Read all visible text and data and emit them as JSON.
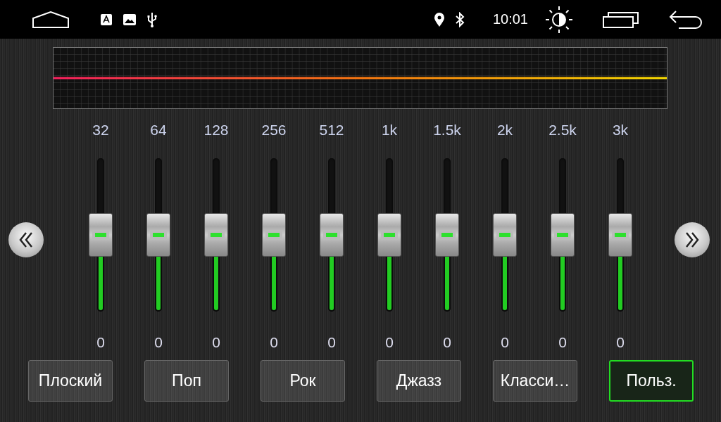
{
  "status_bar": {
    "time": "10:01"
  },
  "bands": [
    {
      "label": "32",
      "value": "0",
      "level": 0.5
    },
    {
      "label": "64",
      "value": "0",
      "level": 0.5
    },
    {
      "label": "128",
      "value": "0",
      "level": 0.5
    },
    {
      "label": "256",
      "value": "0",
      "level": 0.5
    },
    {
      "label": "512",
      "value": "0",
      "level": 0.5
    },
    {
      "label": "1k",
      "value": "0",
      "level": 0.5
    },
    {
      "label": "1.5k",
      "value": "0",
      "level": 0.5
    },
    {
      "label": "2k",
      "value": "0",
      "level": 0.5
    },
    {
      "label": "2.5k",
      "value": "0",
      "level": 0.5
    },
    {
      "label": "3k",
      "value": "0",
      "level": 0.5
    }
  ],
  "presets": [
    {
      "label": "Плоский",
      "selected": false
    },
    {
      "label": "Поп",
      "selected": false
    },
    {
      "label": "Рок",
      "selected": false
    },
    {
      "label": "Джазз",
      "selected": false
    },
    {
      "label": "Класси…",
      "selected": false
    },
    {
      "label": "Польз.",
      "selected": true
    }
  ]
}
